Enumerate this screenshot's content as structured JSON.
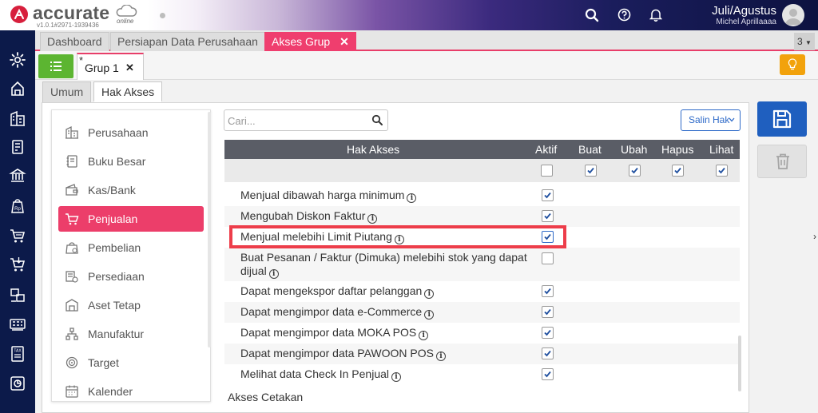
{
  "app": {
    "logo_text": "accurate",
    "logo_sub": "online",
    "version": "v1.0.1#2971-1939436",
    "period": "Juli/Agustus",
    "user": "Michel Aprillaaaa"
  },
  "main_tabs": [
    {
      "label": "Dashboard",
      "active": false
    },
    {
      "label": "Persiapan Data Perusahaan",
      "active": false
    },
    {
      "label": "Akses Grup",
      "active": true
    }
  ],
  "tab_count": "3",
  "sub_tab": {
    "label": "Grup 1",
    "modified_marker": "*"
  },
  "inner_tabs": [
    {
      "label": "Umum",
      "active": false
    },
    {
      "label": "Hak Akses",
      "active": true
    }
  ],
  "menu": {
    "items": [
      {
        "label": "Perusahaan",
        "icon": "building-icon",
        "active": false
      },
      {
        "label": "Buku Besar",
        "icon": "ledger-icon",
        "active": false
      },
      {
        "label": "Kas/Bank",
        "icon": "wallet-icon",
        "active": false
      },
      {
        "label": "Penjualan",
        "icon": "cart-icon",
        "active": true
      },
      {
        "label": "Pembelian",
        "icon": "shopping-bag-icon",
        "active": false
      },
      {
        "label": "Persediaan",
        "icon": "inventory-icon",
        "active": false
      },
      {
        "label": "Aset Tetap",
        "icon": "asset-icon",
        "active": false
      },
      {
        "label": "Manufaktur",
        "icon": "manufacture-icon",
        "active": false
      },
      {
        "label": "Target",
        "icon": "target-icon",
        "active": false
      },
      {
        "label": "Kalender",
        "icon": "calendar-icon",
        "active": false
      }
    ]
  },
  "search": {
    "placeholder": "Cari..."
  },
  "copy_button": {
    "label": "Salin Hak"
  },
  "table": {
    "headers": {
      "name": "Hak Akses",
      "aktif": "Aktif",
      "buat": "Buat",
      "ubah": "Ubah",
      "hapus": "Hapus",
      "lihat": "Lihat"
    },
    "header_checks": {
      "aktif": false,
      "buat": true,
      "ubah": true,
      "hapus": true,
      "lihat": true
    },
    "rows": [
      {
        "label": "Menjual dibawah harga minimum",
        "aktif": true
      },
      {
        "label": "Mengubah Diskon Faktur",
        "aktif": true
      },
      {
        "label": "Menjual melebihi Limit Piutang",
        "aktif": true,
        "highlighted": true
      },
      {
        "label_line1": "Buat Pesanan / Faktur (Dimuka) melebihi stok yang dapat",
        "label_line2": "dijual",
        "aktif": false
      },
      {
        "label": "Dapat mengekspor daftar pelanggan",
        "aktif": true
      },
      {
        "label": "Dapat mengimpor data e-Commerce",
        "aktif": true
      },
      {
        "label": "Dapat mengimpor data MOKA POS",
        "aktif": true
      },
      {
        "label": "Dapat mengimpor data PAWOON POS",
        "aktif": true
      },
      {
        "label": "Melihat data Check In Penjual",
        "aktif": true
      }
    ],
    "section_footer": "Akses Cetakan"
  },
  "colors": {
    "accent_pink": "#ec3e6a",
    "sidebar_navy": "#0c1a4a",
    "save_blue": "#1f5fbf",
    "highlight_red": "#ed3d4a",
    "list_green": "#5cb531",
    "bulb_orange": "#f2a20c"
  }
}
